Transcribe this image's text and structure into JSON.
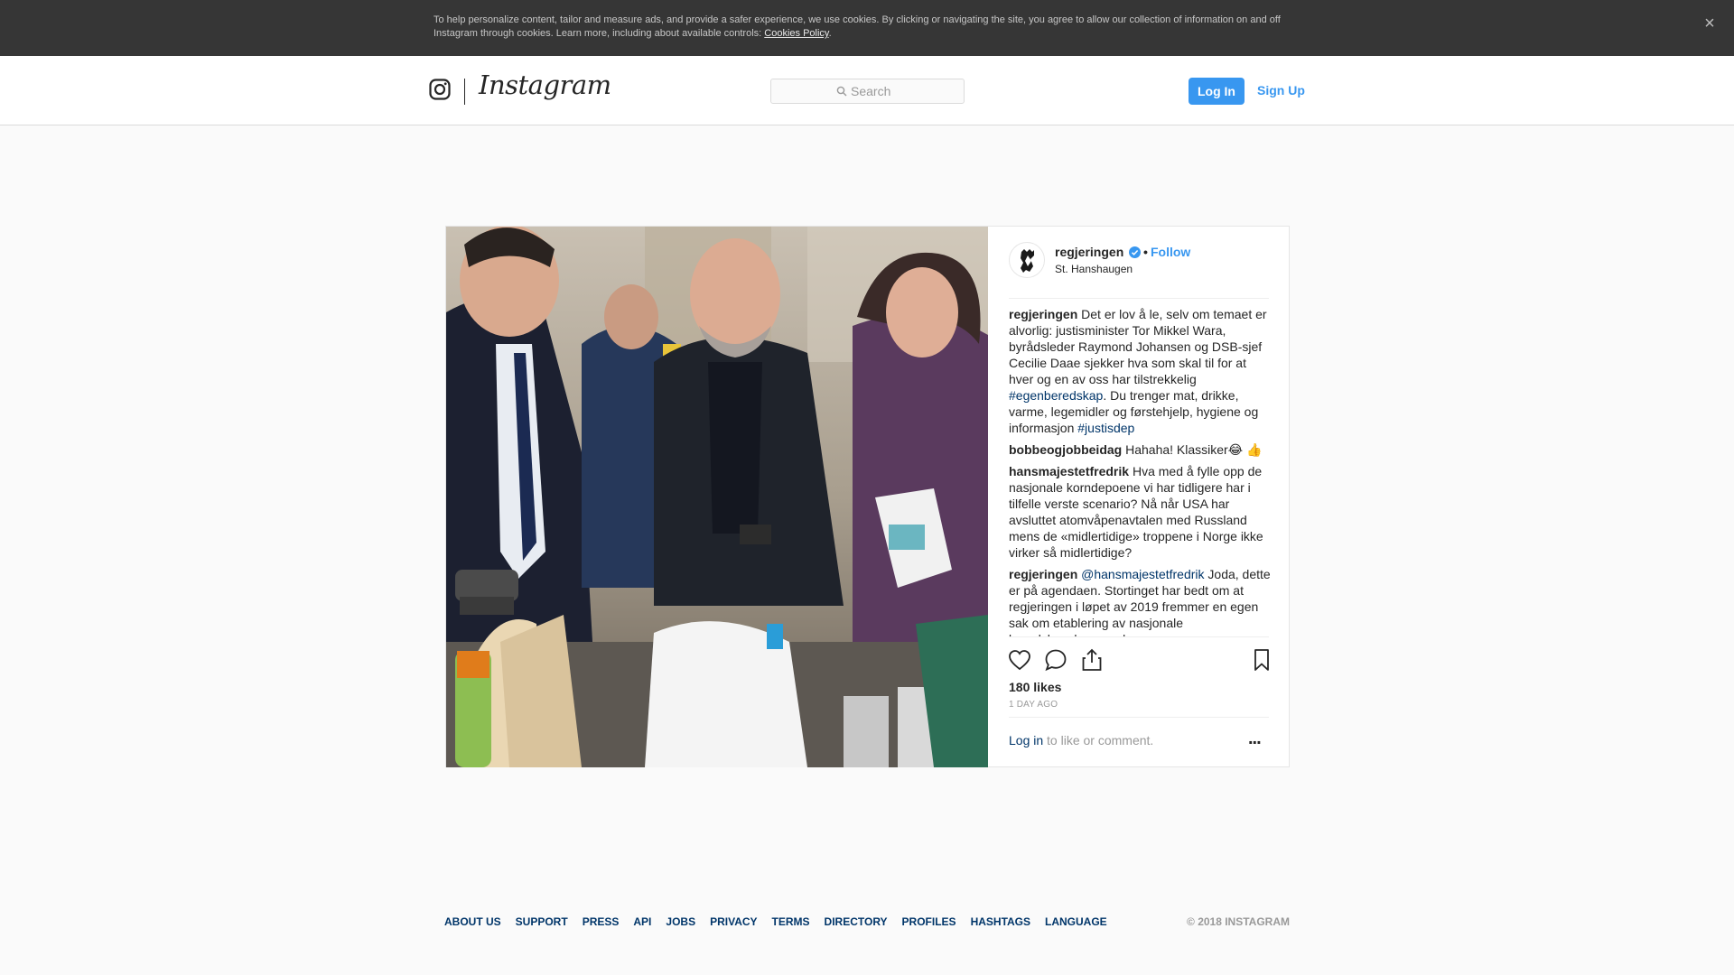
{
  "cookie_banner": {
    "text": "To help personalize content, tailor and measure ads, and provide a safer experience, we use cookies. By clicking or navigating the site, you agree to allow our collection of information on and off Instagram through cookies. Learn more, including about available controls: ",
    "link": "Cookies Policy",
    "suffix": ".",
    "close": "×"
  },
  "nav": {
    "brand": "Instagram",
    "search_placeholder": "Search",
    "login": "Log In",
    "signup": "Sign Up"
  },
  "post": {
    "username": "regjeringen",
    "separator": "•",
    "follow": "Follow",
    "location": "St. Hanshaugen",
    "comments": [
      {
        "user": "regjeringen",
        "parts": [
          {
            "text": "Det er lov å le, selv om temaet er alvorlig: justisminister Tor Mikkel Wara, byrådsleder Raymond Johansen og DSB-sjef Cecilie Daae sjekker hva som skal til for at hver og en av oss har tilstrekkelig "
          },
          {
            "text": "#egenberedskap",
            "link": true
          },
          {
            "text": ". Du trenger mat, drikke, varme, legemidler og førstehjelp, hygiene og informasjon "
          },
          {
            "text": "#justisdep",
            "link": true
          }
        ]
      },
      {
        "user": "bobbeogjobbeidag",
        "parts": [
          {
            "text": "Hahaha! Klassiker😂 👍"
          }
        ]
      },
      {
        "user": "hansmajestetfredrik",
        "parts": [
          {
            "text": "Hva med å fylle opp de nasjonale korndepoene vi har tidligere har i tilfelle verste scenario? Nå når USA har avsluttet atomvåpenavtalen med Russland mens de «midlertidige» troppene i Norge ikke virker så midlertidige?"
          }
        ]
      },
      {
        "user": "regjeringen",
        "parts": [
          {
            "text": "@hansmajestetfredrik",
            "link": true
          },
          {
            "text": " Joda, dette er på agendaen. Stortinget har bedt om at regjeringen i løpet av 2019 fremmer en egen sak om etablering av nasjonale beredskapslagre av korn."
          }
        ]
      }
    ],
    "likes": "180 likes",
    "time": "1 DAY AGO",
    "login_link": "Log in",
    "login_suffix": " to like or comment.",
    "more": "..."
  },
  "footer": {
    "links": [
      "ABOUT US",
      "SUPPORT",
      "PRESS",
      "API",
      "JOBS",
      "PRIVACY",
      "TERMS",
      "DIRECTORY",
      "PROFILES",
      "HASHTAGS",
      "LANGUAGE"
    ],
    "copyright": "© 2018 INSTAGRAM"
  },
  "colors": {
    "accent": "#3897f0",
    "link": "#003569",
    "banner": "#363636"
  }
}
